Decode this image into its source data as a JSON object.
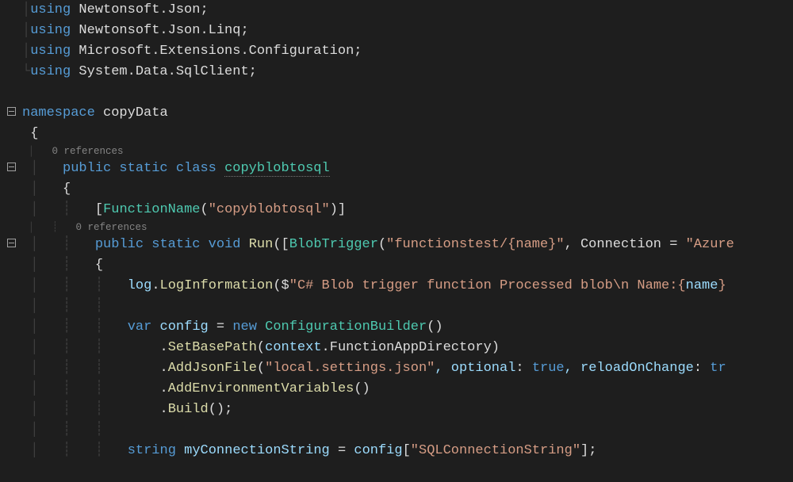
{
  "refs": {
    "zero": "0 references"
  },
  "code": {
    "using1_kw": "using",
    "using1_rest": " Newtonsoft.Json;",
    "using2_kw": "using",
    "using2_rest": " Newtonsoft.Json.Linq;",
    "using3_kw": "using",
    "using3_rest": " Microsoft.Extensions.Configuration;",
    "using4_kw": "using",
    "using4_rest": " System.Data.SqlClient;",
    "ns_kw": "namespace",
    "ns_name": " copyData",
    "obrace": "{",
    "cls_mod": "public static class ",
    "cls_name": "copyblobtosql",
    "cls_obrace": "{",
    "attr_open": "[",
    "attr_name": "FunctionName",
    "attr_paren": "(",
    "attr_str": "\"copyblobtosql\"",
    "attr_close": ")]",
    "run_mod": "public static void ",
    "run_name": "Run",
    "run_p_open": "([",
    "run_trig": "BlobTrigger",
    "run_p2": "(",
    "run_str1": "\"functionstest/{name}\"",
    "run_sep": ", Connection = ",
    "run_str2": "\"Azure",
    "run_obrace": "{",
    "log_var": "log",
    "log_dot": ".",
    "log_meth": "LogInformation",
    "log_open": "($",
    "log_str": "\"C# Blob trigger function Processed blob\\n Name:{",
    "log_name": "name",
    "log_close": "} ",
    "var_kw": "var",
    "var_sp": " ",
    "var_name": "config",
    "var_eq": " = ",
    "var_new": "new",
    "var_sp2": " ",
    "var_type": "ConfigurationBuilder",
    "var_end": "()",
    "sbp_dot": ".",
    "sbp_meth": "SetBasePath",
    "sbp_open": "(",
    "sbp_ctx": "context",
    "sbp_dot2": ".",
    "sbp_prop": "FunctionAppDirectory",
    "sbp_close": ")",
    "ajf_dot": ".",
    "ajf_meth": "AddJsonFile",
    "ajf_open": "(",
    "ajf_str": "\"local.settings.json\"",
    "ajf_p1k": ", optional",
    "ajf_p1c": ": ",
    "ajf_p1v": "true",
    "ajf_p2k": ", reloadOnChange",
    "ajf_p2c": ": ",
    "ajf_p2v": "tr",
    "aev_dot": ".",
    "aev_meth": "AddEnvironmentVariables",
    "aev_end": "()",
    "bld_dot": ".",
    "bld_meth": "Build",
    "bld_end": "();",
    "cs_kw": "string",
    "cs_sp": " ",
    "cs_var": "myConnectionString",
    "cs_eq": " = ",
    "cs_cfg": "config",
    "cs_idx": "[",
    "cs_str": "\"SQLConnectionString\"",
    "cs_end": "];"
  }
}
